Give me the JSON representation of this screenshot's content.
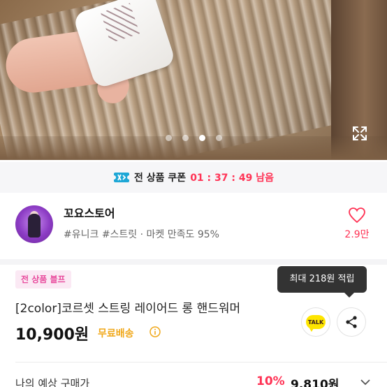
{
  "hero": {
    "image_description": "",
    "carousel": {
      "total": 4,
      "active_index": 2
    }
  },
  "icons": {
    "expand": "expand-icon",
    "coupon": "coupon-icon",
    "heart": "heart-icon",
    "info": "info-icon",
    "kakao": "kakaotalk-icon",
    "share": "share-icon",
    "chevron": "chevron-down-icon"
  },
  "coupon": {
    "label": "전 상품 쿠폰",
    "timer": "01 : 37 : 49 남음"
  },
  "store": {
    "name": "꼬요스토어",
    "tags": "#유니크 #스트릿 · 마켓 만족도 95%",
    "like_count": "2.9만"
  },
  "product": {
    "badge": "전 상품 블프",
    "tooltip": "최대 218원 적립",
    "title": "[2color]코르셋 스트링 레이어드 롱 핸드워머",
    "price": "10,900원",
    "free_shipping": "무료배송",
    "kakao_label": "TALK"
  },
  "expected_price": {
    "label": "나의 예상 구매가",
    "discount": "10%",
    "final_price": "9,810원"
  },
  "colors": {
    "accent_pink": "#ff3355",
    "badge_text": "#e84a9c",
    "badge_bg": "#fbe9f4",
    "free_shipping": "#f0a81a",
    "kakao_yellow": "#fee500"
  }
}
